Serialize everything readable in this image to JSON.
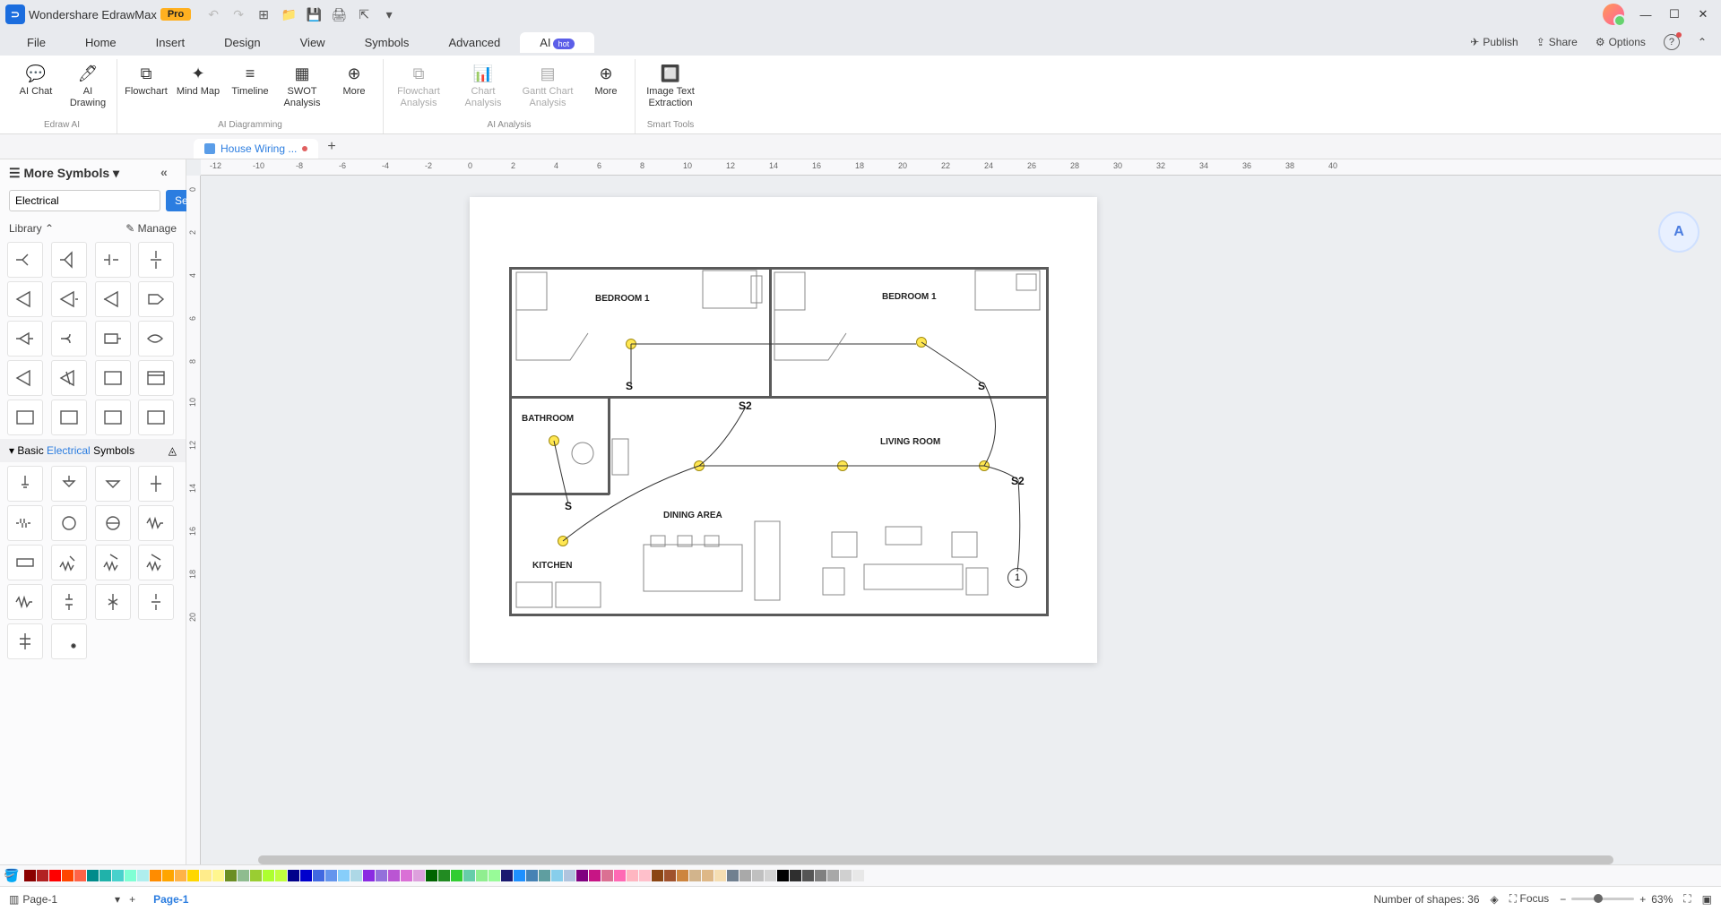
{
  "app": {
    "title": "Wondershare EdrawMax",
    "badge": "Pro"
  },
  "menus": {
    "file": "File",
    "home": "Home",
    "insert": "Insert",
    "design": "Design",
    "view": "View",
    "symbols": "Symbols",
    "advanced": "Advanced",
    "ai": "AI",
    "ai_badge": "hot"
  },
  "menubar_right": {
    "publish": "Publish",
    "share": "Share",
    "options": "Options"
  },
  "ribbon": {
    "groups": {
      "edraw_ai": {
        "label": "Edraw AI",
        "ai_chat": "AI Chat",
        "ai_drawing": "AI Drawing"
      },
      "diagramming": {
        "label": "AI Diagramming",
        "flowchart": "Flowchart",
        "mindmap": "Mind Map",
        "timeline": "Timeline",
        "swot": "SWOT Analysis",
        "more": "More"
      },
      "analysis": {
        "label": "AI Analysis",
        "flowchart_analysis": "Flowchart Analysis",
        "chart_analysis": "Chart Analysis",
        "gantt_analysis": "Gantt Chart Analysis",
        "more": "More"
      },
      "smart": {
        "label": "Smart Tools",
        "image_text": "Image Text Extraction"
      }
    }
  },
  "doc_tab": {
    "name": "House Wiring ..."
  },
  "leftpanel": {
    "title": "More Symbols",
    "search_value": "Electrical",
    "search_btn": "Search",
    "library": "Library",
    "manage": "Manage",
    "section": {
      "prefix": "Basic ",
      "highlight": "Electrical",
      "suffix": " Symbols"
    }
  },
  "floorplan": {
    "bedroom1a": "BEDROOM 1",
    "bedroom1b": "BEDROOM 1",
    "bathroom": "BATHROOM",
    "living": "LIVING ROOM",
    "dining": "DINING AREA",
    "kitchen": "KITCHEN",
    "s1": "S",
    "s2": "S2",
    "s3": "S",
    "s4": "S2",
    "s5": "S",
    "node1": "1"
  },
  "ruler_h": [
    "-12",
    "-10",
    "-8",
    "-6",
    "-4",
    "-2",
    "0",
    "2",
    "4",
    "6",
    "8",
    "10",
    "12",
    "14",
    "16",
    "18",
    "20",
    "22",
    "24",
    "26",
    "28",
    "30",
    "32",
    "34",
    "36",
    "38",
    "40"
  ],
  "ruler_v": [
    "0",
    "2",
    "4",
    "6",
    "8",
    "10",
    "12",
    "14",
    "16",
    "18",
    "20"
  ],
  "statusbar": {
    "page_sel": "Page-1",
    "page_tab": "Page-1",
    "shapes": "Number of shapes: 36",
    "focus": "Focus",
    "zoom": "63%"
  },
  "colors": [
    "#8b0000",
    "#b22222",
    "#ff0000",
    "#ff4500",
    "#ff6347",
    "#008b8b",
    "#20b2aa",
    "#48d1cc",
    "#7fffd4",
    "#afeeee",
    "#ff8c00",
    "#ffa500",
    "#ffb347",
    "#ffd700",
    "#ffec8b",
    "#fff68f",
    "#6b8e23",
    "#8fbc8f",
    "#9acd32",
    "#adff2f",
    "#c0ff3e",
    "#00008b",
    "#0000cd",
    "#4169e1",
    "#6495ed",
    "#87cefa",
    "#add8e6",
    "#8a2be2",
    "#9370db",
    "#ba55d3",
    "#da70d6",
    "#dda0dd",
    "#006400",
    "#228b22",
    "#32cd32",
    "#66cdaa",
    "#90ee90",
    "#98fb98",
    "#191970",
    "#1e90ff",
    "#4682b4",
    "#5f9ea0",
    "#87ceeb",
    "#b0c4de",
    "#800080",
    "#c71585",
    "#db7093",
    "#ff69b4",
    "#ffb6c1",
    "#ffc0cb",
    "#8b4513",
    "#a0522d",
    "#cd853f",
    "#d2b48c",
    "#deb887",
    "#f5deb3",
    "#708090",
    "#a9a9a9",
    "#c0c0c0",
    "#d3d3d3",
    "#000000",
    "#2f2f2f",
    "#555555",
    "#808080",
    "#a8a8a8",
    "#d0d0d0",
    "#e8e8e8"
  ]
}
